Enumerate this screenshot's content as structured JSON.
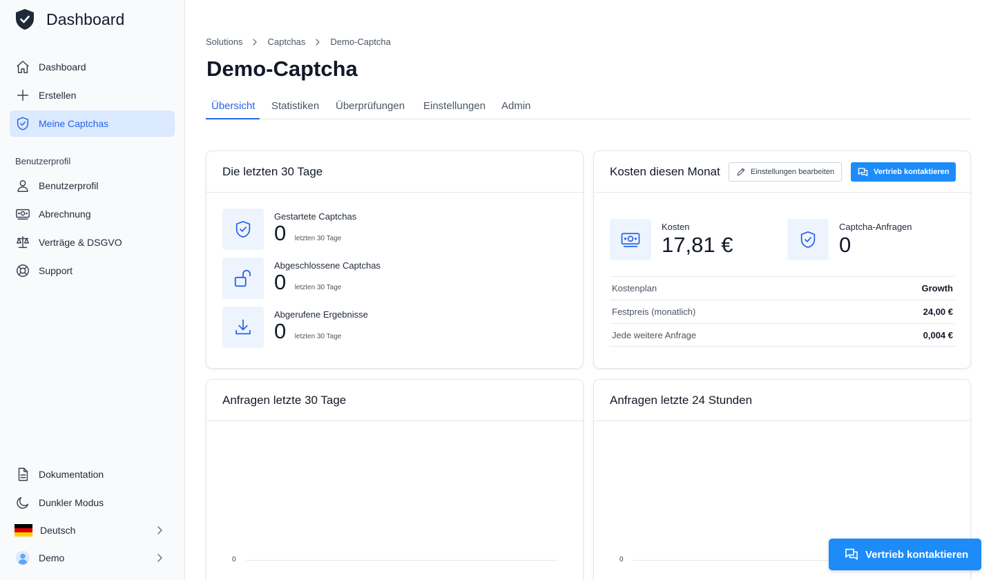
{
  "app": {
    "title": "Dashboard"
  },
  "sidebar": {
    "items": [
      {
        "label": "Dashboard",
        "icon": "home-icon"
      },
      {
        "label": "Erstellen",
        "icon": "plus-icon"
      },
      {
        "label": "Meine Captchas",
        "icon": "shield-check-icon",
        "active": true
      }
    ],
    "profile_section": "Benutzerprofil",
    "profile_items": [
      {
        "label": "Benutzerprofil",
        "icon": "user-icon"
      },
      {
        "label": "Abrechnung",
        "icon": "money-icon"
      },
      {
        "label": "Verträge & DSGVO",
        "icon": "scale-icon"
      },
      {
        "label": "Support",
        "icon": "lifebuoy-icon"
      }
    ],
    "bottom_items": [
      {
        "label": "Dokumentation",
        "icon": "document-icon"
      },
      {
        "label": "Dunkler Modus",
        "icon": "moon-icon"
      },
      {
        "label": "Deutsch",
        "icon": "flag-de-icon"
      },
      {
        "label": "Demo",
        "icon": "avatar-icon"
      }
    ]
  },
  "breadcrumb": [
    "Solutions",
    "Captchas",
    "Demo-Captcha"
  ],
  "page": {
    "title": "Demo-Captcha"
  },
  "tabs": [
    "Übersicht",
    "Statistiken",
    "Überprüfungen",
    "Einstellungen",
    "Admin"
  ],
  "last30": {
    "title": "Die letzten 30 Tage",
    "stats": [
      {
        "label": "Gestartete Captchas",
        "value": "0",
        "sub": "letzten 30 Tage"
      },
      {
        "label": "Abgeschlossene Captchas",
        "value": "0",
        "sub": "letzten 30 Tage"
      },
      {
        "label": "Abgerufene Ergebnisse",
        "value": "0",
        "sub": "letzten 30 Tage"
      }
    ]
  },
  "costs": {
    "title": "Kosten diesen Monat",
    "edit_button": "Einstellungen bearbeiten",
    "contact_button": "Vertrieb kontaktieren",
    "cost_label": "Kosten",
    "cost_value": "17,81 €",
    "requests_label": "Captcha-Anfragen",
    "requests_value": "0",
    "plan": [
      {
        "key": "Kostenplan",
        "value": "Growth"
      },
      {
        "key": "Festpreis (monatlich)",
        "value": "24,00 €"
      },
      {
        "key": "Jede weitere Anfrage",
        "value": "0,004 €"
      }
    ]
  },
  "charts": [
    {
      "title": "Anfragen letzte 30 Tage",
      "y_tick": "0"
    },
    {
      "title": "Anfragen letzte 24 Stunden",
      "y_tick": "0"
    }
  ],
  "float_button": "Vertrieb kontaktieren",
  "colors": {
    "accent": "#2563eb",
    "primary_button": "#1d8cf8",
    "active_bg": "#dbeafe",
    "icon_bg": "#eef4fd"
  }
}
